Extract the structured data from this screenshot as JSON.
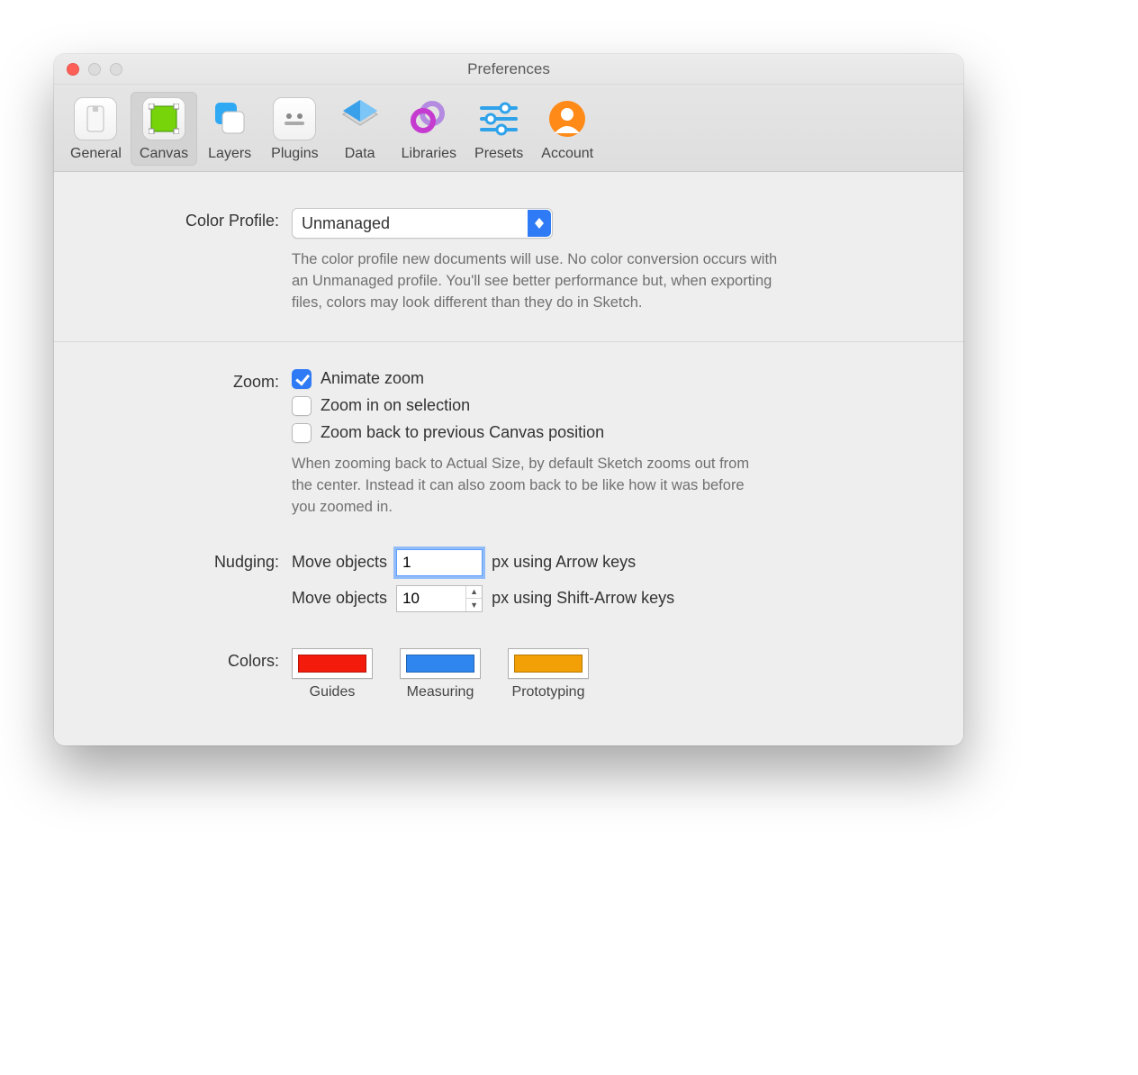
{
  "window": {
    "title": "Preferences"
  },
  "tabs": [
    {
      "id": "general",
      "label": "General"
    },
    {
      "id": "canvas",
      "label": "Canvas",
      "selected": true
    },
    {
      "id": "layers",
      "label": "Layers"
    },
    {
      "id": "plugins",
      "label": "Plugins"
    },
    {
      "id": "data",
      "label": "Data"
    },
    {
      "id": "libraries",
      "label": "Libraries"
    },
    {
      "id": "presets",
      "label": "Presets"
    },
    {
      "id": "account",
      "label": "Account"
    }
  ],
  "section_color_profile": {
    "label": "Color Profile:",
    "value": "Unmanaged",
    "description": "The color profile new documents will use. No color conversion occurs with an Unmanaged profile. You'll see better performance but, when exporting files, colors may look different than they do in Sketch."
  },
  "section_zoom": {
    "label": "Zoom:",
    "options": [
      {
        "label": "Animate zoom",
        "checked": true
      },
      {
        "label": "Zoom in on selection",
        "checked": false
      },
      {
        "label": "Zoom back to previous Canvas position",
        "checked": false
      }
    ],
    "description": "When zooming back to Actual Size, by default Sketch zooms out from the center. Instead it can also zoom back to be like how it was before you zoomed in."
  },
  "section_nudging": {
    "label": "Nudging:",
    "line1_prefix": "Move objects",
    "line1_value": "1",
    "line1_suffix": "px using Arrow keys",
    "line2_prefix": "Move objects",
    "line2_value": "10",
    "line2_suffix": "px using Shift-Arrow keys"
  },
  "section_colors": {
    "label": "Colors:",
    "items": [
      {
        "label": "Guides",
        "color": "#f31b0c"
      },
      {
        "label": "Measuring",
        "color": "#2f86ee"
      },
      {
        "label": "Prototyping",
        "color": "#f2a006"
      }
    ]
  }
}
